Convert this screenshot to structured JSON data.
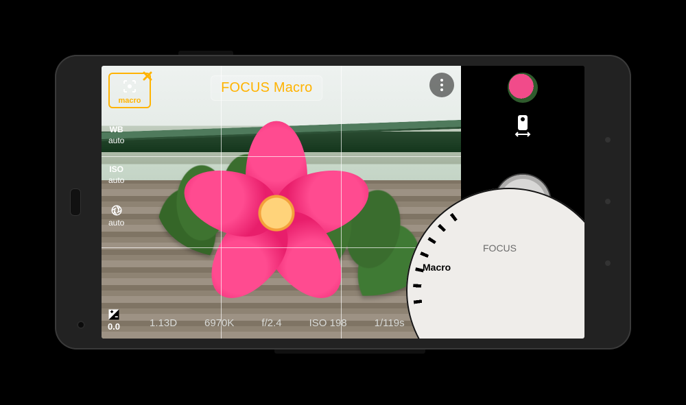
{
  "accent": "#ffb300",
  "focus_chip": {
    "label": "macro"
  },
  "focus_title": "FOCUS Macro",
  "modes": {
    "wb": {
      "top": "WB",
      "value": "auto"
    },
    "iso": {
      "top": "ISO",
      "value": "auto"
    },
    "aperture": {
      "value": "auto"
    }
  },
  "ev": {
    "value": "0.0"
  },
  "exif": {
    "distance": "1.13D",
    "temp": "6970K",
    "f": "f/2.4",
    "iso": "ISO 198",
    "shutter": "1/119s"
  },
  "dial": {
    "selected": "Macro",
    "secondary": "FOCUS"
  }
}
